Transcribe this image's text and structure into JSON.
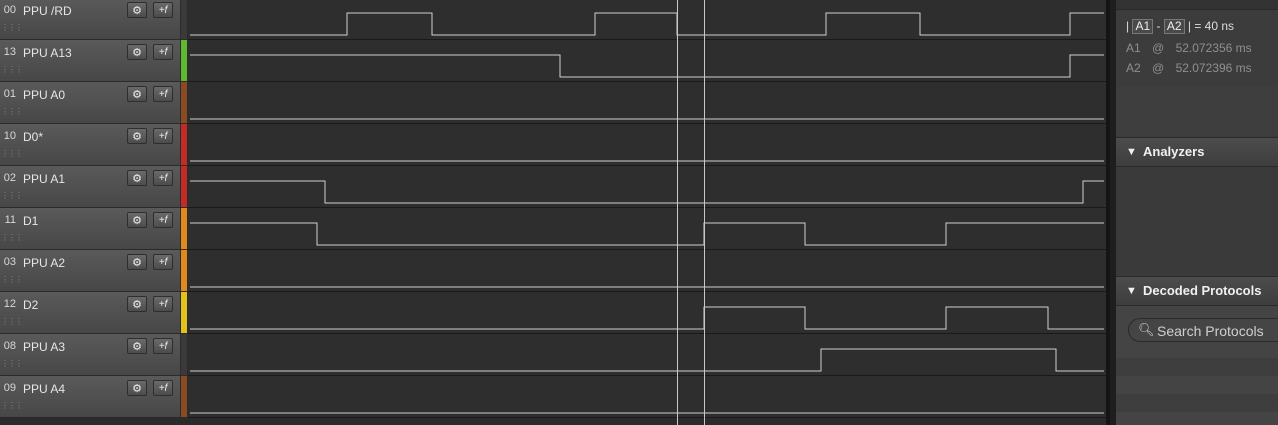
{
  "channels": [
    {
      "num": "00",
      "name": "PPU /RD",
      "color": "#3a3a3a"
    },
    {
      "num": "13",
      "name": "PPU A13",
      "color": "#5fb832"
    },
    {
      "num": "01",
      "name": "PPU A0",
      "color": "#8a4b22"
    },
    {
      "num": "10",
      "name": "D0*",
      "color": "#c42a26"
    },
    {
      "num": "02",
      "name": "PPU A1",
      "color": "#c42a26"
    },
    {
      "num": "11",
      "name": "D1",
      "color": "#e08a1c"
    },
    {
      "num": "03",
      "name": "PPU A2",
      "color": "#e08a1c"
    },
    {
      "num": "12",
      "name": "D2",
      "color": "#e4c21c"
    },
    {
      "num": "08",
      "name": "PPU A3",
      "color": "#3a3a3a"
    },
    {
      "num": "09",
      "name": "PPU A4",
      "color": "#8a4b22"
    }
  ],
  "channel_buttons": {
    "settings_icon": "gear-icon",
    "trigger_label": "+f"
  },
  "waveforms": [
    {
      "initial": 0,
      "transitions": [
        347,
        432,
        595,
        677,
        826,
        920,
        1070
      ]
    },
    {
      "initial": 1,
      "transitions": [
        560,
        1070
      ]
    },
    {
      "initial": 0,
      "transitions": []
    },
    {
      "initial": 0,
      "transitions": []
    },
    {
      "initial": 1,
      "transitions": [
        325,
        1083
      ]
    },
    {
      "initial": 1,
      "transitions": [
        317,
        704,
        805,
        946
      ]
    },
    {
      "initial": 0,
      "transitions": []
    },
    {
      "initial": 0,
      "transitions": [
        704,
        805,
        946,
        1048
      ]
    },
    {
      "initial": 0,
      "transitions": [
        821,
        1056
      ]
    },
    {
      "initial": 0,
      "transitions": []
    }
  ],
  "cursors": {
    "A1": 677,
    "A2": 704
  },
  "measurements": {
    "delta_bar1": "|",
    "a1_tag": "A1",
    "dash": "-",
    "a2_tag": "A2",
    "delta_bar2": "|",
    "delta_value": "= 40 ns",
    "a1_label": "A1",
    "a1_at": "@",
    "a1_time": "52.072356 ms",
    "a2_label": "A2",
    "a2_at": "@",
    "a2_time": "52.072396 ms"
  },
  "analyzers": {
    "title": "Analyzers",
    "triangle": "▼"
  },
  "decoded_protocols": {
    "title": "Decoded Protocols",
    "triangle": "▼",
    "search_placeholder": "Search Protocols",
    "search_icon": "search-icon"
  }
}
